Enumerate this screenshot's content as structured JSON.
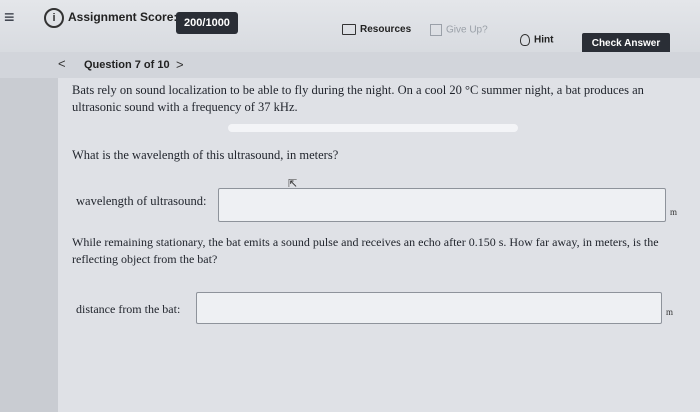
{
  "header": {
    "menu_icon": "hamburger-menu-icon",
    "info_icon": "info-icon",
    "score_label": "Assignment Score:",
    "score_value": "200/1000",
    "resources_label": "Resources",
    "giveup_label": "Give Up?",
    "hint_label": "Hint",
    "check_answer_label": "Check Answer"
  },
  "question_nav": {
    "prev": "<",
    "title": "Question 7 of 10",
    "next": ">"
  },
  "question": {
    "intro": "Bats rely on sound localization to be able to fly during the night. On a cool 20 °C summer night, a bat produces an ultrasonic sound with a frequency of 37 kHz.",
    "part1_prompt": "What is the wavelength of this ultrasound, in meters?",
    "part1_label": "wavelength of ultrasound:",
    "part1_value": "",
    "part1_unit": "m",
    "part2_prompt": "While remaining stationary, the bat emits a sound pulse and receives an echo after 0.150 s. How far away, in meters, is the reflecting object from the bat?",
    "part2_label": "distance from the bat:",
    "part2_value": "",
    "part2_unit": "m"
  },
  "colors": {
    "dark_button": "#2a2e36",
    "panel": "#dfe1e6"
  }
}
